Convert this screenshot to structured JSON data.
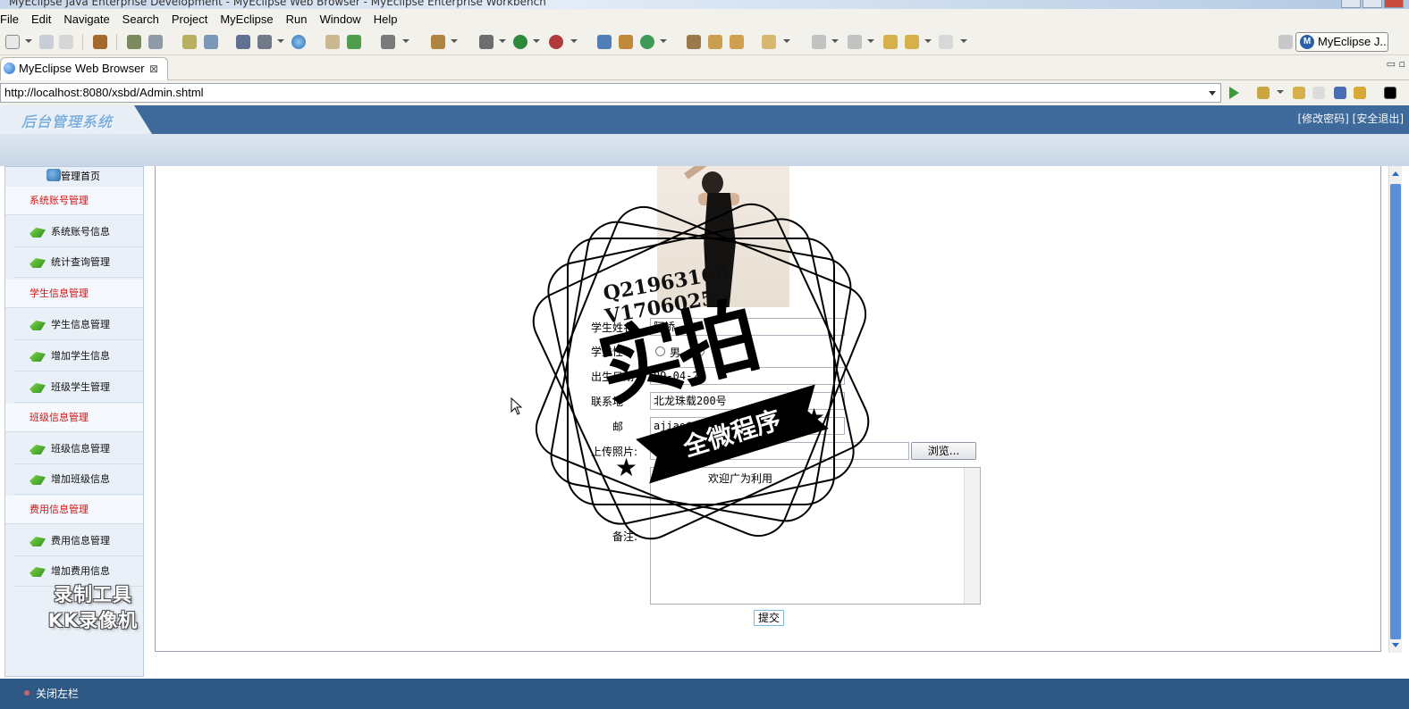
{
  "window": {
    "title": "MyEclipse Java Enterprise Development - MyEclipse Web Browser - MyEclipse Enterprise Workbench"
  },
  "menubar": {
    "items": [
      "File",
      "Edit",
      "Navigate",
      "Search",
      "Project",
      "MyEclipse",
      "Run",
      "Window",
      "Help"
    ]
  },
  "toolbar": {
    "perspective_label": "MyEclipse J...",
    "perspective_icon": "M"
  },
  "editor_tab": {
    "label": "MyEclipse Web Browser",
    "close_glyph": "⊠"
  },
  "address_bar": {
    "url": "http://localhost:8080/xsbd/Admin.shtml"
  },
  "app": {
    "logo_text": "后台管理系统",
    "top_links": "[修改密码] [安全退出]",
    "home_label": "管理首页",
    "footer_label": "关闭左栏"
  },
  "sidebar": {
    "sections": [
      {
        "title": "系统账号管理",
        "items": [
          "系统账号信息",
          "统计查询管理"
        ]
      },
      {
        "title": "学生信息管理",
        "items": [
          "学生信息管理",
          "增加学生信息",
          "班级学生管理"
        ]
      },
      {
        "title": "班级信息管理",
        "items": [
          "班级信息管理",
          "增加班级信息"
        ]
      },
      {
        "title": "费用信息管理",
        "items": [
          "费用信息管理",
          "增加费用信息"
        ]
      }
    ]
  },
  "recorder_watermark": {
    "line1": "录制工具",
    "line2": "KK录像机"
  },
  "form": {
    "name_label": "学生姓名:",
    "name_value": "阿娇",
    "gender_label": "学生性",
    "gender_option": "男",
    "birth_label": "出生日期",
    "birth_value": "09-04-2",
    "contact_label": "联系地",
    "contact_value": "北龙珠载200号",
    "email_label": "邮",
    "email_value": "ajiao@163.c",
    "photo_label": "上传照片:",
    "browse_label": "浏览...",
    "remarks_text": "欢迎广为利用",
    "remarks_label": "备注:",
    "submit_label": "提交"
  },
  "stamp": {
    "line1": "Q21963168",
    "line2": "V17060256",
    "big": "实拍",
    "ribbon": "全微程序"
  },
  "colors": {
    "app_header": "#3e6a9b",
    "footer": "#2f5985",
    "section_title": "#d01414",
    "scroll_thumb": "#5b8ed8"
  }
}
